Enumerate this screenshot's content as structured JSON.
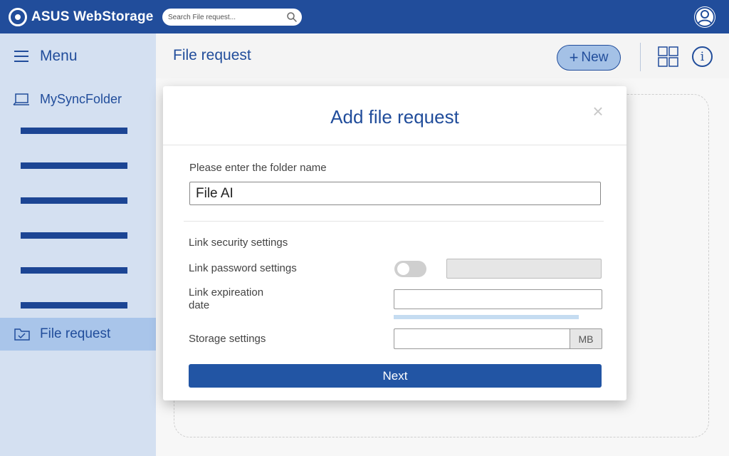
{
  "app": {
    "name": "ASUS WebStorage"
  },
  "search": {
    "placeholder": "Search File request..."
  },
  "colors": {
    "primary": "#214d9b",
    "sidebar_bg": "#d4e0f1",
    "sidebar_active": "#a9c5ea",
    "accent_button": "#2255a4"
  },
  "sidebar": {
    "menu_label": "Menu",
    "sync_folder_label": "MySyncFolder",
    "active_item_label": "File request"
  },
  "header": {
    "title": "File request",
    "new_button_plus": "+",
    "new_button_label": "New",
    "info_glyph": "i"
  },
  "modal": {
    "title": "Add file request",
    "close_glyph": "×",
    "folder_name_label": "Please enter the folder name",
    "folder_name_value": "File AI",
    "link_security_label": "Link security settings",
    "link_password_label": "Link password settings",
    "link_password_enabled": false,
    "link_expiration_label": "Link expireation date",
    "storage_label": "Storage settings",
    "storage_unit": "MB",
    "next_button": "Next"
  }
}
